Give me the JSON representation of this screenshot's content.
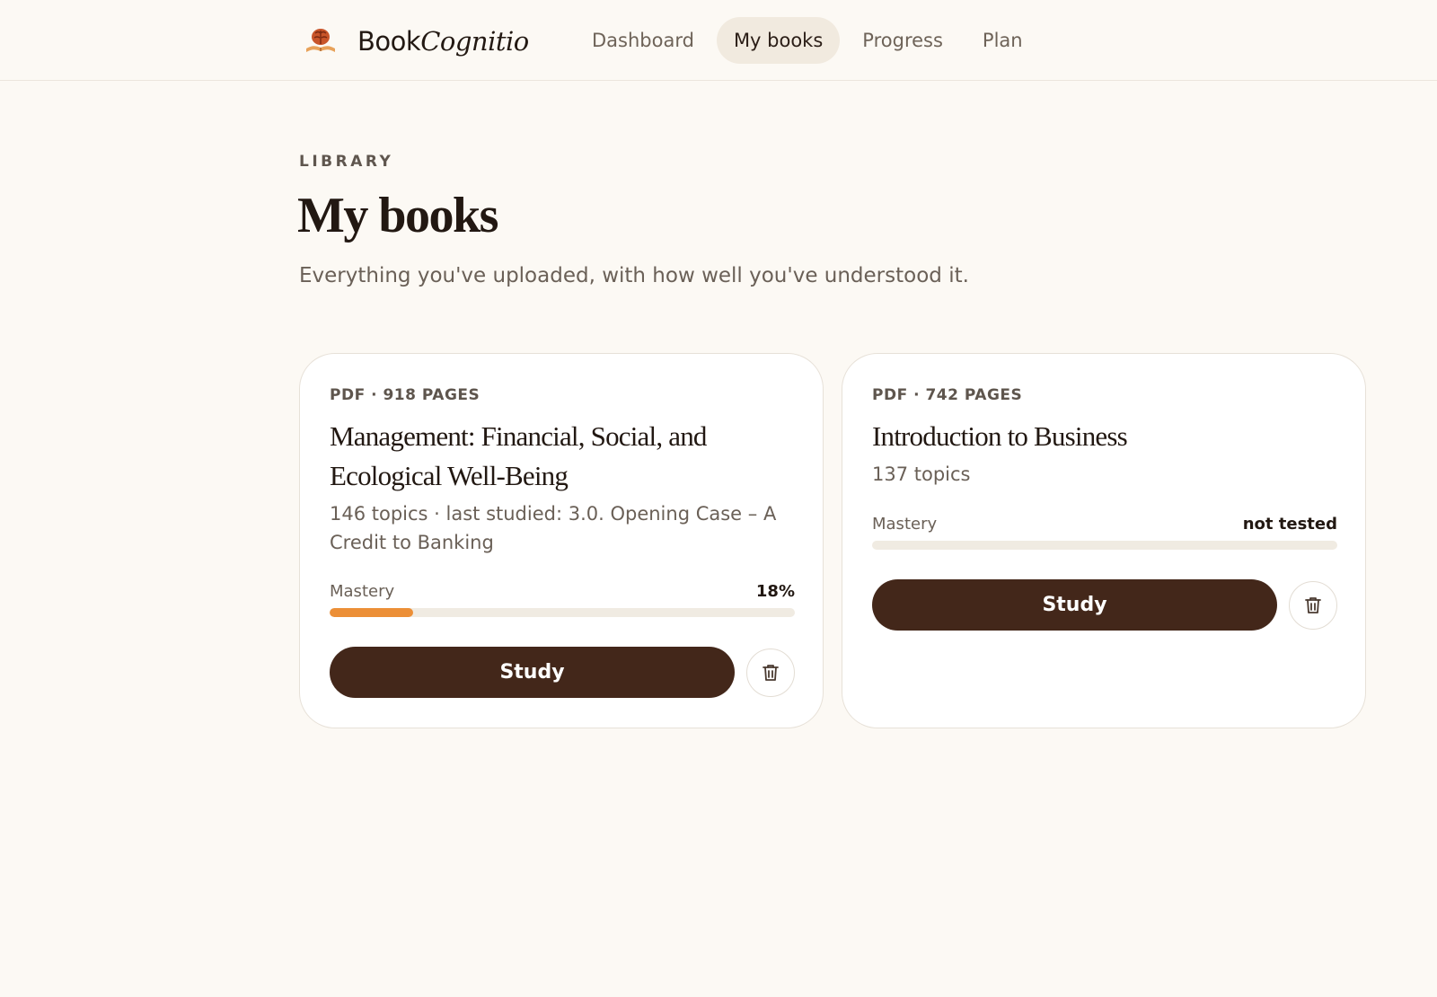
{
  "app": {
    "brand_name": "Book",
    "brand_name_italic": "Cognitio",
    "logo_icon": "brain-book-icon"
  },
  "nav": {
    "items": [
      {
        "label": "Dashboard",
        "active": false
      },
      {
        "label": "My books",
        "active": true
      },
      {
        "label": "Progress",
        "active": false
      },
      {
        "label": "Plan",
        "active": false
      }
    ]
  },
  "header": {
    "eyebrow": "LIBRARY",
    "title": "My books",
    "subtitle": "Everything you've uploaded, with how well you've understood it."
  },
  "books": [
    {
      "meta": "PDF · 918 PAGES",
      "title": "Management: Financial, Social, and Ecological Well-Being",
      "description": "146 topics · last studied: 3.0. Opening Case – A Credit to Banking",
      "mastery_label": "Mastery",
      "mastery_value": "18%",
      "mastery_fraction": 0.18,
      "study_label": "Study",
      "delete_icon": "trash-icon"
    },
    {
      "meta": "PDF · 742 PAGES",
      "title": "Introduction to Business",
      "description": "137 topics",
      "mastery_label": "Mastery",
      "mastery_value": "not tested",
      "mastery_fraction": 0,
      "study_label": "Study",
      "delete_icon": "trash-icon"
    }
  ],
  "colors": {
    "background": "#fcf9f4",
    "accent": "#43271a",
    "progress": "#ec8f37",
    "nav_active": "#f1eadf"
  }
}
